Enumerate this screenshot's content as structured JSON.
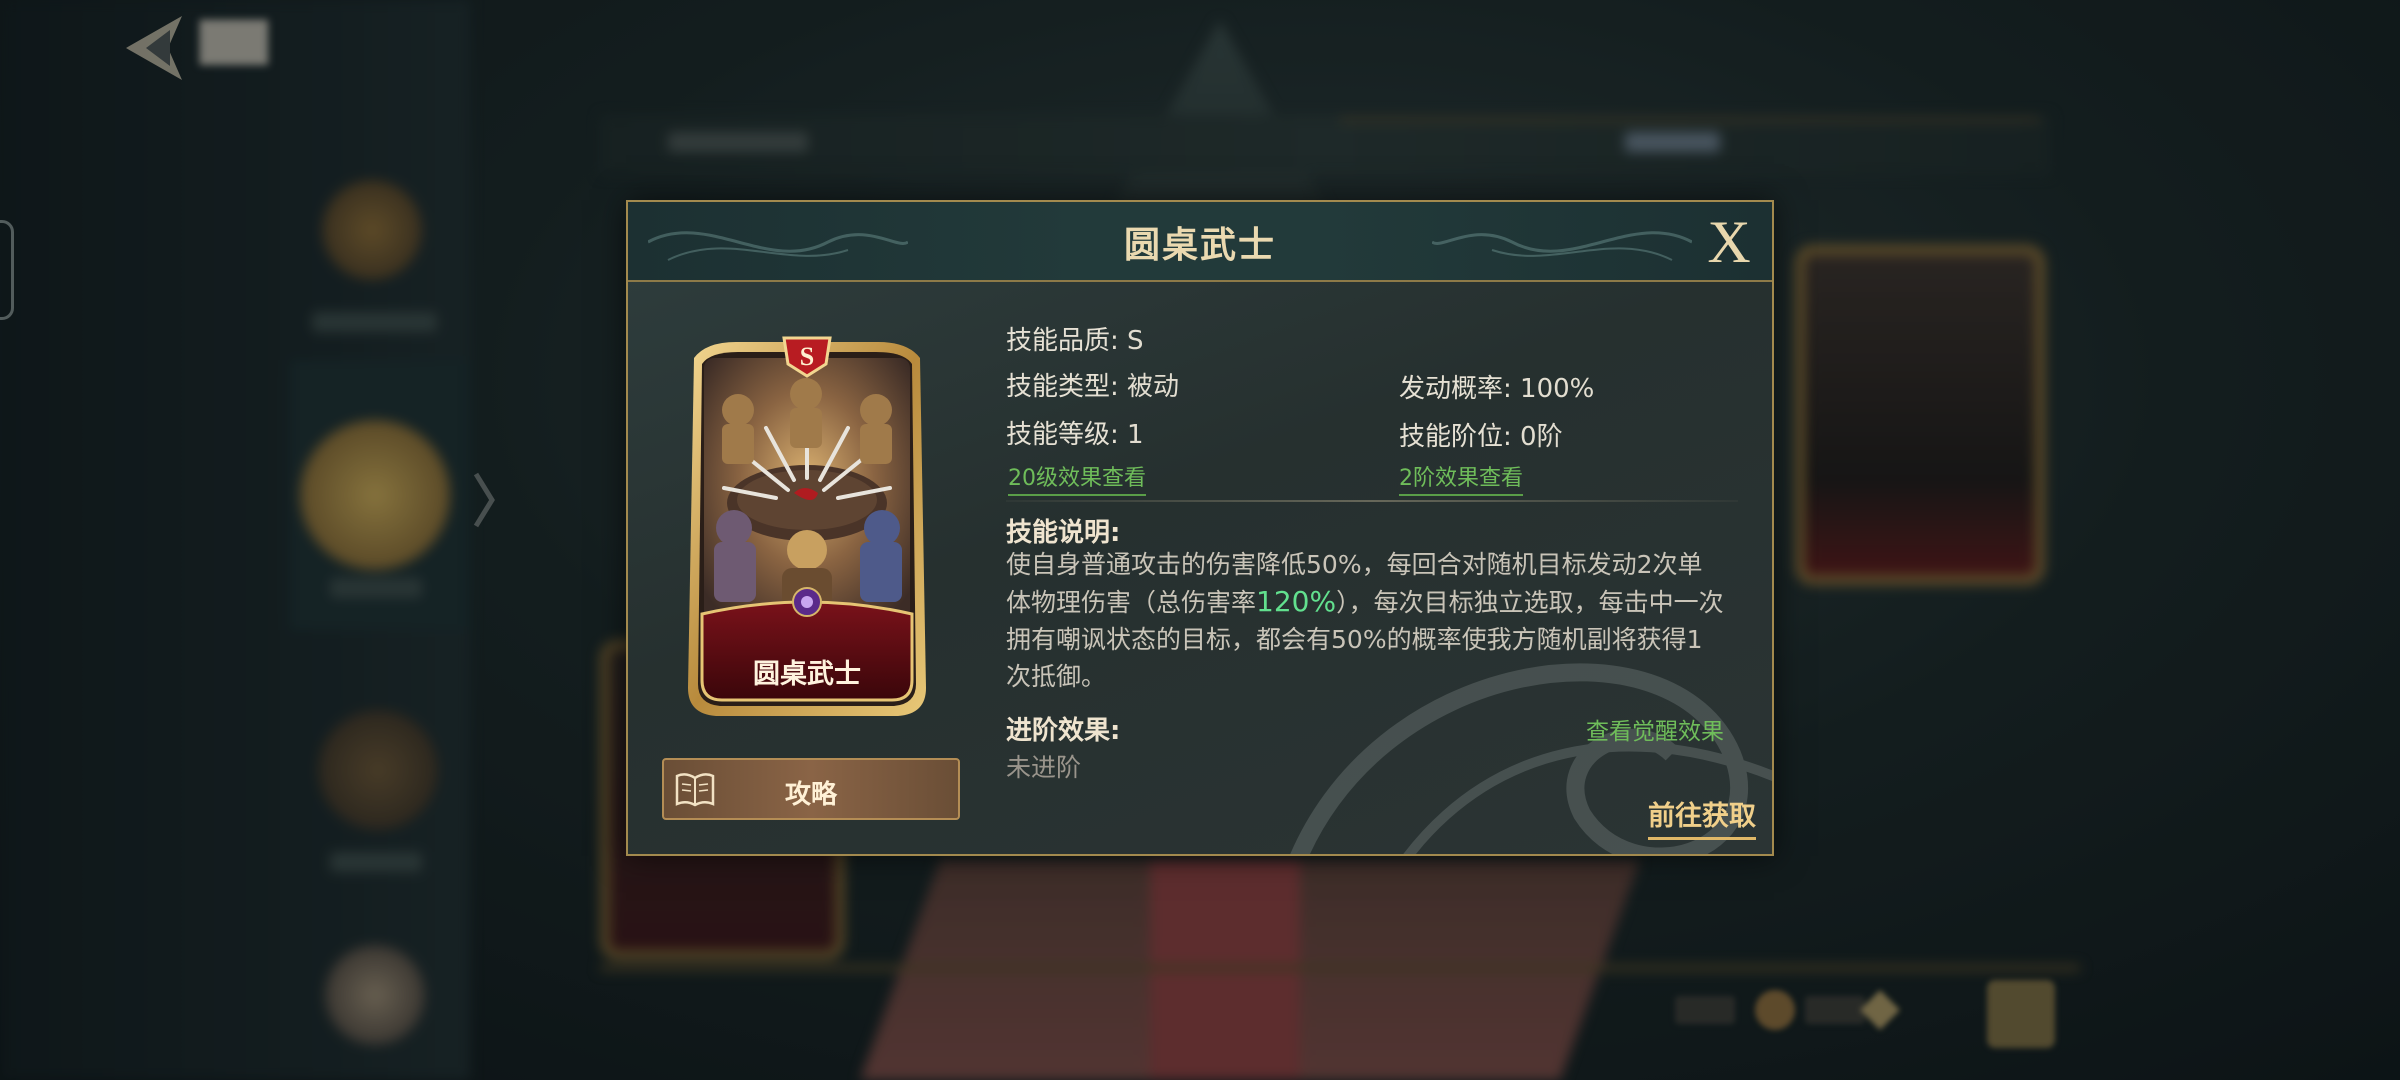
{
  "modal": {
    "title": "圆桌武士",
    "close_label": "X"
  },
  "card": {
    "name": "圆桌武士",
    "grade_badge": "S",
    "frame_color": "#c9a24e",
    "name_plate_color": "#5a0c12"
  },
  "guide_button": {
    "label": "攻略",
    "icon": "book-icon"
  },
  "skill": {
    "quality_label": "技能品质:",
    "quality_value": "S",
    "type_label": "技能类型:",
    "type_value": "被动",
    "trigger_label": "发动概率:",
    "trigger_value": "100%",
    "level_label": "技能等级:",
    "level_value": "1",
    "stage_label": "技能阶位:",
    "stage_value": "0阶",
    "level_effect_link": "20级效果查看",
    "stage_effect_link": "2阶效果查看"
  },
  "description": {
    "title": "技能说明:",
    "text_part1": "使自身普通攻击的伤害降低50%，每回合对随机目标发动2次单体物理伤害（总伤害率",
    "highlight": "120%",
    "text_part2": "），每次目标独立选取，每击中一次拥有嘲讽状态的目标，都会有50%的概率使我方随机副将获得1次抵御。",
    "highlight_color": "#62e08e"
  },
  "advancement": {
    "title": "进阶效果:",
    "value": "未进阶",
    "awaken_link": "查看觉醒效果"
  },
  "goto_button": {
    "label": "前往获取"
  },
  "background": {
    "back_icon": "back-arrow-icon"
  }
}
